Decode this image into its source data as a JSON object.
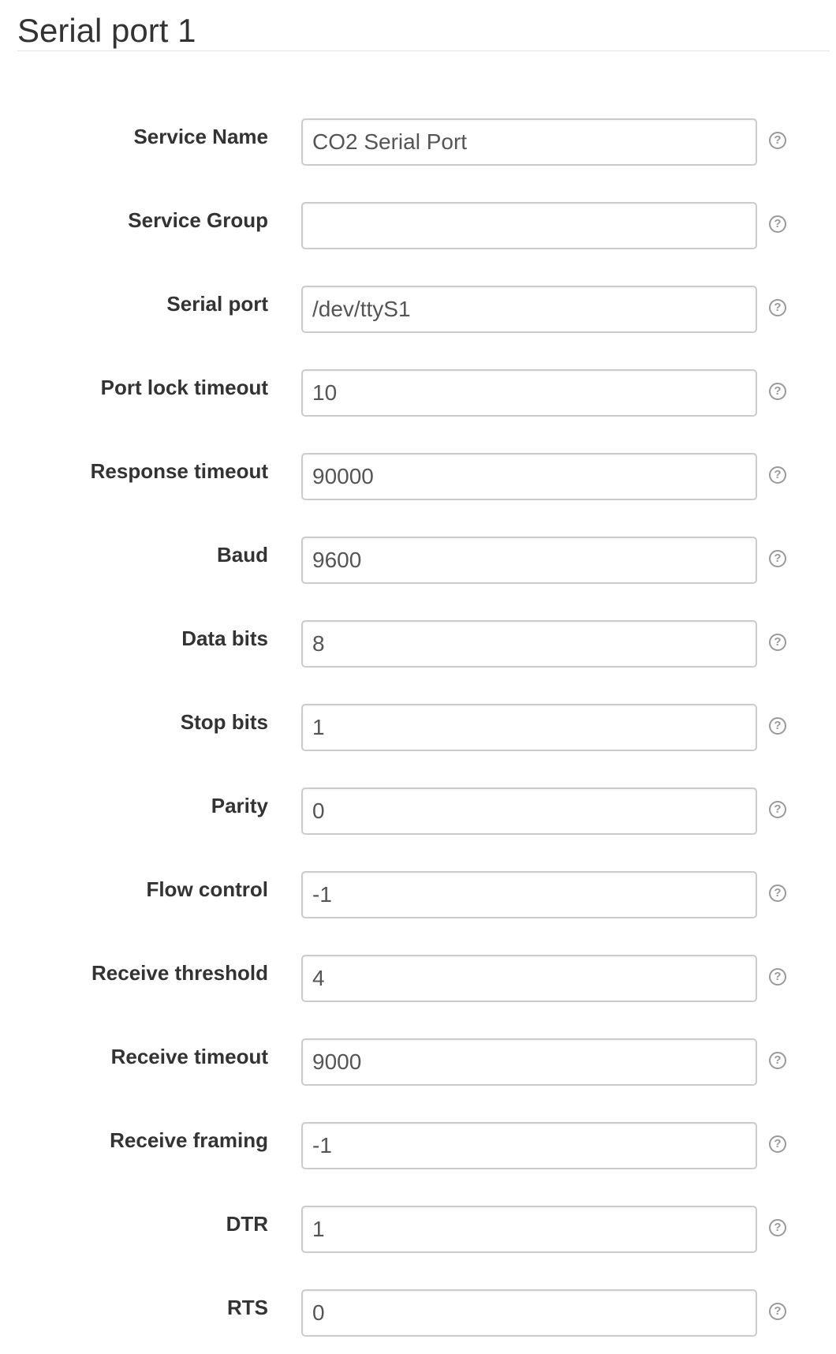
{
  "section": {
    "title": "Serial port 1"
  },
  "icons": {
    "help": "question-circle-icon",
    "help_glyph": "?"
  },
  "form": {
    "fields": [
      {
        "label": "Service Name",
        "value": "CO2 Serial Port"
      },
      {
        "label": "Service Group",
        "value": ""
      },
      {
        "label": "Serial port",
        "value": "/dev/ttyS1"
      },
      {
        "label": "Port lock timeout",
        "value": "10"
      },
      {
        "label": "Response timeout",
        "value": "90000"
      },
      {
        "label": "Baud",
        "value": "9600"
      },
      {
        "label": "Data bits",
        "value": "8"
      },
      {
        "label": "Stop bits",
        "value": "1"
      },
      {
        "label": "Parity",
        "value": "0"
      },
      {
        "label": "Flow control",
        "value": "-1"
      },
      {
        "label": "Receive threshold",
        "value": "4"
      },
      {
        "label": "Receive timeout",
        "value": "9000"
      },
      {
        "label": "Receive framing",
        "value": "-1"
      },
      {
        "label": "DTR",
        "value": "1"
      },
      {
        "label": "RTS",
        "value": "0"
      }
    ]
  }
}
